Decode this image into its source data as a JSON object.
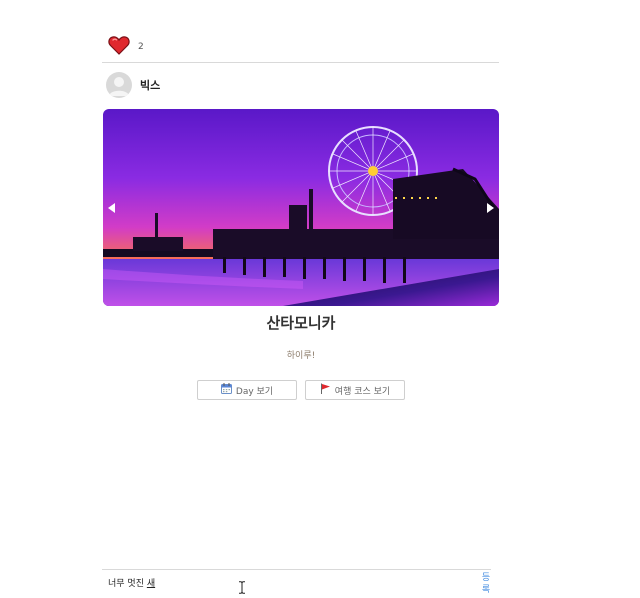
{
  "post": {
    "like_count": "2",
    "author_name": "빅스",
    "title": "산타모니카",
    "subtitle": "하이루!"
  },
  "actions": {
    "day_button": "Day 보기",
    "course_button": "여행 코스 보기"
  },
  "comment": {
    "typed_text": "너무 멋진 ",
    "composing_char": "새",
    "submit_label": "등록"
  },
  "colors": {
    "heart": "#e0282e",
    "link": "#4a90e2",
    "divider": "#d9d9d9"
  }
}
